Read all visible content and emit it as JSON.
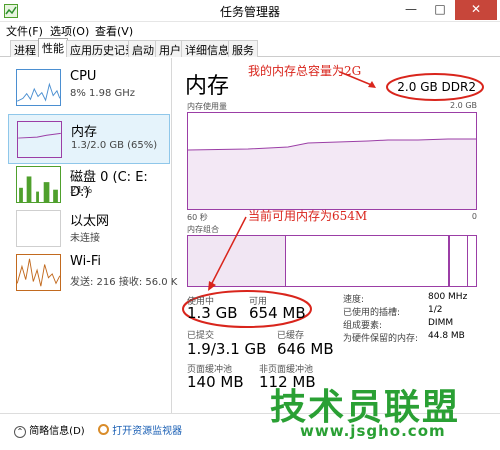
{
  "window": {
    "title": "任务管理器",
    "min": "—",
    "max": "□",
    "close": "✕"
  },
  "menu": [
    "文件(F)",
    "选项(O)",
    "查看(V)"
  ],
  "tabs": [
    "进程",
    "性能",
    "应用历史记录",
    "启动",
    "用户",
    "详细信息",
    "服务"
  ],
  "active_tab": "性能",
  "sidebar": [
    {
      "title": "CPU",
      "sub": "8% 1.98 GHz"
    },
    {
      "title": "内存",
      "sub": "1.3/2.0 GB (65%)"
    },
    {
      "title": "磁盘 0 (C: E: D:)",
      "sub": "21%"
    },
    {
      "title": "以太网",
      "sub": "未连接"
    },
    {
      "title": "Wi-Fi",
      "sub": "发送: 216 接收: 56.0 K"
    }
  ],
  "main": {
    "title": "内存",
    "total": "2.0 GB DDR2",
    "usage_label": "内存使用量",
    "usage_max": "2.0 GB",
    "time_label": "60 秒",
    "time_end": "0",
    "composition_label": "内存组合",
    "in_use_label": "使用中",
    "in_use": "1.3 GB",
    "available_label": "可用",
    "available": "654 MB",
    "committed_label": "已提交",
    "committed": "1.9/3.1 GB",
    "cached_label": "已缓存",
    "cached": "646 MB",
    "paged_label": "页面缓冲池",
    "paged": "140 MB",
    "nonpaged_label": "非页面缓冲池",
    "nonpaged": "112 MB",
    "speed_label": "速度:",
    "speed": "800 MHz",
    "slots_label": "已使用的插槽:",
    "slots": "1/2",
    "form_label": "组成要素:",
    "form": "DIMM",
    "reserved_label": "为硬件保留的内存:",
    "reserved": "44.8 MB"
  },
  "annotations": {
    "total": "我的内存总容量为2G",
    "available": "当前可用内存为654M"
  },
  "footer": {
    "brief": "简略信息(D)",
    "resmon": "打开资源监视器"
  },
  "watermark": {
    "text": "技术员联盟",
    "url": "www.jsgho.com"
  },
  "colors": {
    "memory": "#9b3ea6",
    "cpu": "#4b8fd1",
    "disk": "#4fa02d",
    "wifi": "#c26a1f",
    "annotation": "#d9251c"
  }
}
